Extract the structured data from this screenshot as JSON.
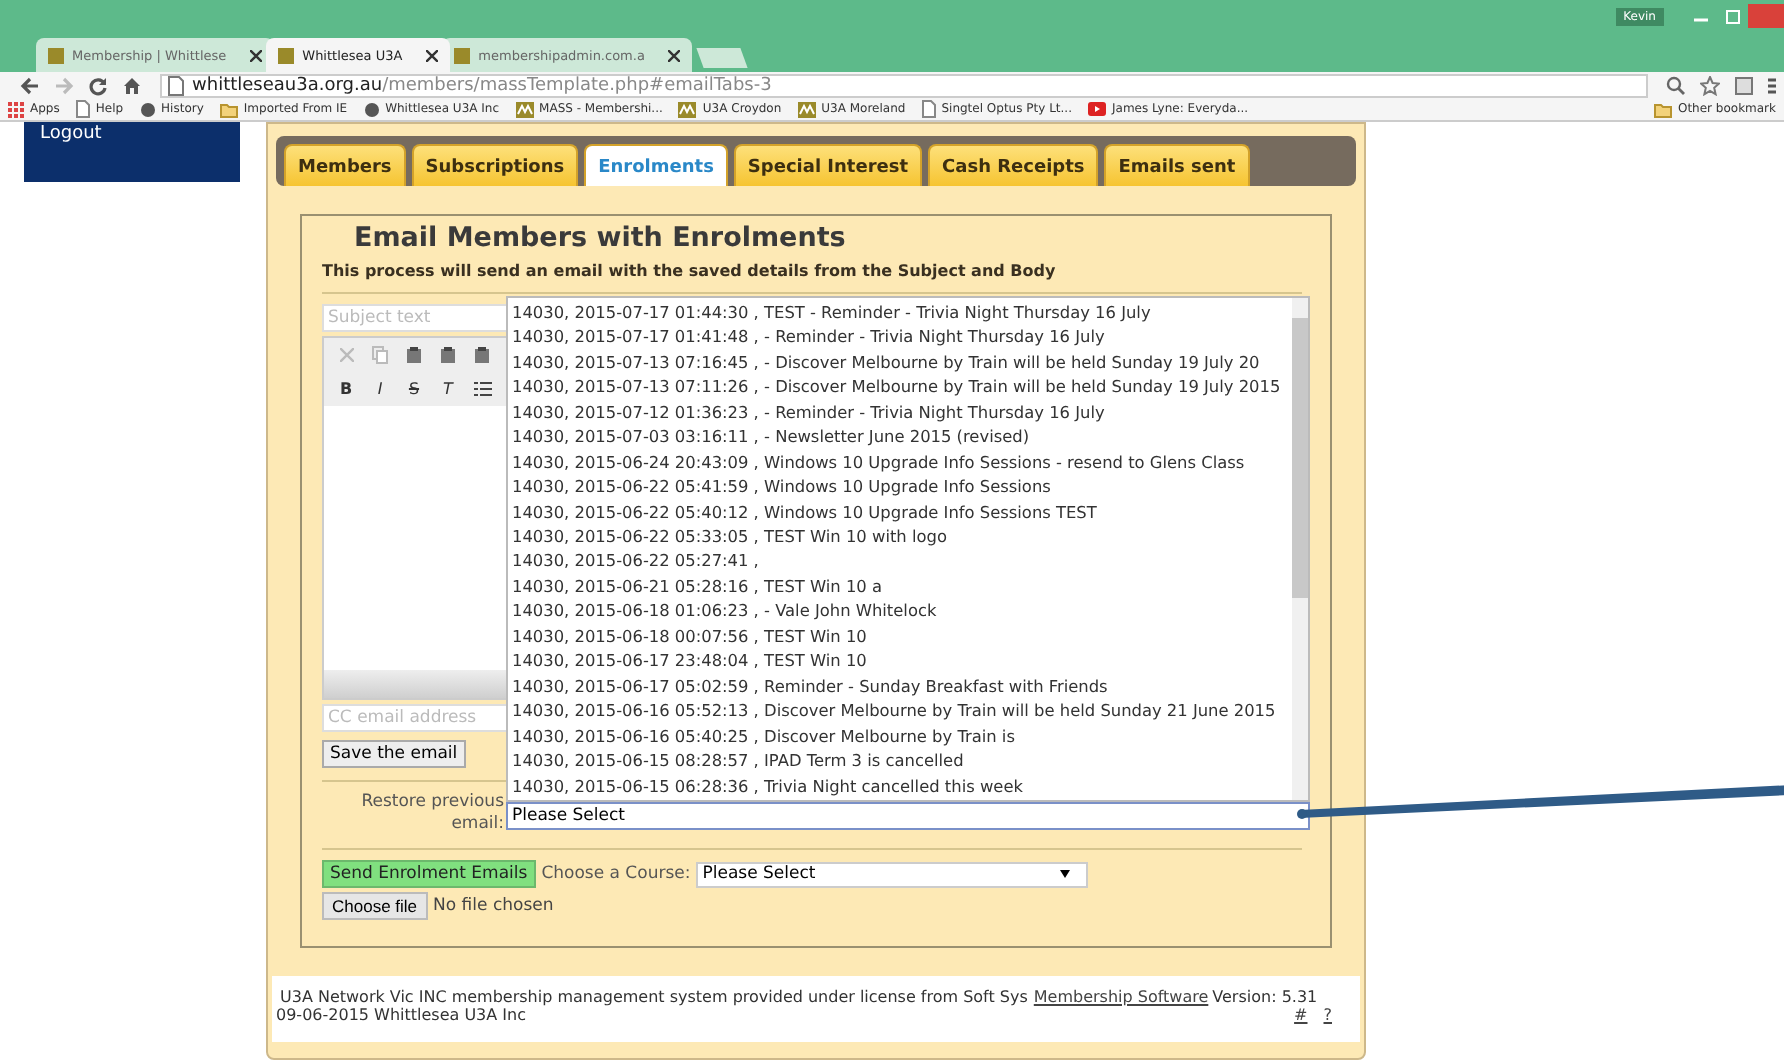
{
  "browser": {
    "tabs": [
      {
        "label": "Membership | Whittlese",
        "selected": false
      },
      {
        "label": "Whittlesea U3A",
        "selected": true
      },
      {
        "label": "membershipadmin.com.a",
        "selected": false
      }
    ],
    "user": "Kevin",
    "address": {
      "host": "whittleseau3a.org.au",
      "path": "/members/massTemplate.php#emailTabs-3"
    },
    "bookmarks": [
      {
        "label": "Apps",
        "kind": "apps"
      },
      {
        "label": "Help",
        "kind": "page"
      },
      {
        "label": "History",
        "kind": "dot"
      },
      {
        "label": "Imported From IE",
        "kind": "folder"
      },
      {
        "label": "Whittlesea U3A Inc",
        "kind": "dot"
      },
      {
        "label": "MASS - Membershi...",
        "kind": "site"
      },
      {
        "label": "U3A Croydon",
        "kind": "site"
      },
      {
        "label": "U3A Moreland",
        "kind": "site"
      },
      {
        "label": "Singtel Optus Pty Lt...",
        "kind": "page"
      },
      {
        "label": "James Lyne: Everyda...",
        "kind": "video"
      }
    ],
    "other_bookmarks": "Other bookmark"
  },
  "sidebar": {
    "link": "Logout"
  },
  "tabs": [
    {
      "label": "Members",
      "selected": false
    },
    {
      "label": "Subscriptions",
      "selected": false
    },
    {
      "label": "Enrolments",
      "selected": true
    },
    {
      "label": "Special Interest",
      "selected": false
    },
    {
      "label": "Cash Receipts",
      "selected": false
    },
    {
      "label": "Emails sent",
      "selected": false
    }
  ],
  "form": {
    "title": "Email Members with Enrolments",
    "description": "This process will send an email with the saved details from the Subject and Body",
    "subject_placeholder": "Subject text",
    "format_buttons": [
      {
        "glyph": "B",
        "kind": "bold"
      },
      {
        "glyph": "I",
        "kind": "italic"
      },
      {
        "glyph": "S",
        "kind": "strike"
      },
      {
        "glyph": "T",
        "kind": "clear"
      }
    ],
    "cc_placeholder": "CC email address",
    "save_button": "Save the email",
    "restore_label": "Restore previous email:",
    "restore_value": "Please Select",
    "restore_options": [
      "14030, 2015-07-17 01:44:30 , TEST - Reminder - Trivia Night Thursday 16 July",
      "14030, 2015-07-17 01:41:48 , - Reminder - Trivia Night Thursday 16 July",
      "14030, 2015-07-13 07:16:45 , - Discover Melbourne by Train will be held Sunday 19 July 20",
      "14030, 2015-07-13 07:11:26 , - Discover Melbourne by Train will be held Sunday 19 July 2015",
      "14030, 2015-07-12 01:36:23 , - Reminder - Trivia Night Thursday 16 July",
      "14030, 2015-07-03 03:16:11 , - Newsletter June 2015 (revised)",
      "14030, 2015-06-24 20:43:09 , Windows 10 Upgrade Info Sessions - resend to Glens Class",
      "14030, 2015-06-22 05:41:59 , Windows 10 Upgrade Info Sessions",
      "14030, 2015-06-22 05:40:12 , Windows 10 Upgrade Info Sessions TEST",
      "14030, 2015-06-22 05:33:05 , TEST Win 10 with logo",
      "14030, 2015-06-22 05:27:41 ,",
      "14030, 2015-06-21 05:28:16 , TEST Win 10 a",
      "14030, 2015-06-18 01:06:23 , - Vale John Whitelock",
      "14030, 2015-06-18 00:07:56 , TEST Win 10",
      "14030, 2015-06-17 23:48:04 , TEST Win 10",
      "14030, 2015-06-17 05:02:59 , Reminder - Sunday Breakfast with Friends",
      "14030, 2015-06-16 05:52:13 , Discover Melbourne by Train will be held Sunday 21 June 2015",
      "14030, 2015-06-16 05:40:25 , Discover Melbourne by Train is",
      "14030, 2015-06-15 08:28:57 , IPAD Term 3 is cancelled",
      "14030, 2015-06-15 06:28:36 , Trivia Night cancelled this week"
    ],
    "send_button": "Send Enrolment Emails",
    "course_label": "Choose a Course:",
    "course_value": "Please Select",
    "file_button": "Choose file",
    "file_status": "No file chosen"
  },
  "footer": {
    "text": "U3A Network Vic INC membership management system provided under license from Soft Sys",
    "link": "Membership Software",
    "version": "Version: 5.31",
    "date_line": "09-06-2015 Whittlesea U3A Inc",
    "links": [
      "#",
      "?"
    ]
  }
}
